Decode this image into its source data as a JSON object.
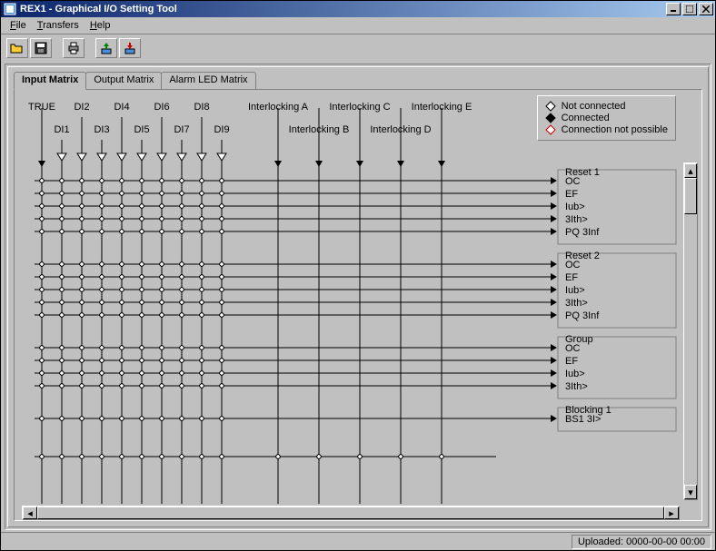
{
  "window": {
    "title": "REX1 - Graphical I/O Setting Tool"
  },
  "menu": {
    "file": "File",
    "transfers": "Transfers",
    "help": "Help"
  },
  "toolbar": {
    "open": "Open",
    "save": "Save",
    "print": "Print",
    "download": "Download",
    "upload": "Upload"
  },
  "tabs": {
    "input": "Input Matrix",
    "output": "Output Matrix",
    "alarm": "Alarm LED Matrix"
  },
  "legend": {
    "not_connected": "Not connected",
    "connected": "Connected",
    "not_possible": "Connection not possible"
  },
  "columns_top": [
    "TRUE",
    "",
    "DI2",
    "",
    "DI4",
    "",
    "DI6",
    "",
    "DI8",
    "",
    "",
    "Interlocking A",
    "",
    "Interlocking C",
    "",
    "Interlocking E"
  ],
  "columns_bot": [
    "",
    "DI1",
    "",
    "DI3",
    "",
    "DI5",
    "",
    "DI7",
    "",
    "DI9",
    "",
    "",
    "Interlocking B",
    "",
    "Interlocking D",
    ""
  ],
  "groups": [
    {
      "title": "Reset 1",
      "rows": [
        "OC",
        "EF",
        "Iub>",
        "3Ith>",
        "PQ 3Inf"
      ]
    },
    {
      "title": "Reset 2",
      "rows": [
        "OC",
        "EF",
        "Iub>",
        "3Ith>",
        "PQ 3Inf"
      ]
    },
    {
      "title": "Group",
      "rows": [
        "OC",
        "EF",
        "Iub>",
        "3Ith>"
      ]
    },
    {
      "title": "Blocking 1",
      "rows": [
        "BS1 3I>"
      ]
    }
  ],
  "status": {
    "uploaded": "Uploaded: 0000-00-00 00:00"
  }
}
